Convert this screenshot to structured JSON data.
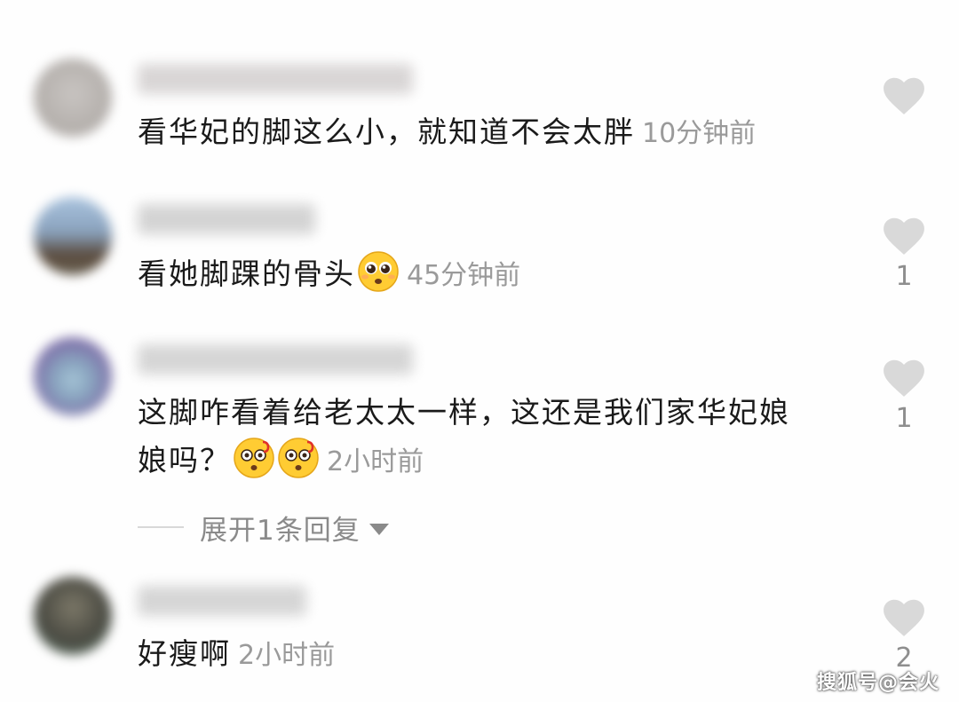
{
  "comments": [
    {
      "text": "看华妃的脚这么小，就知道不会太胖",
      "time": "10分钟前",
      "likes": "",
      "avatar_color": "#b8b4b0",
      "name_color": "#d6d3d3"
    },
    {
      "text": "看她脚踝的骨头",
      "time": "45分钟前",
      "likes": "1",
      "avatar_color": "#6f7f94",
      "name_color": "#d2d2d2"
    },
    {
      "text_line1": "这脚咋看着给老太太一样，这还是我们家华妃娘",
      "text_line2": "娘吗？",
      "time": "2小时前",
      "likes": "1",
      "avatar_color": "#7a6ea6",
      "name_color": "#d5d5d5"
    },
    {
      "text": "好瘦啊",
      "time": "2小时前",
      "likes": "2",
      "avatar_color": "#5c5a52",
      "name_color": "#d4d4d4"
    }
  ],
  "expand_replies": "展开1条回复",
  "watermark": "搜狐号@会火",
  "icons": {
    "like": "heart-icon",
    "emoji_pleading": "pleading-face-emoji",
    "emoji_dizzy": "dizzy-face-emoji",
    "expand": "caret-down-icon"
  },
  "colors": {
    "heart": "#d6d6d6",
    "time": "#9a9a9a",
    "text": "#1a1a1a"
  }
}
